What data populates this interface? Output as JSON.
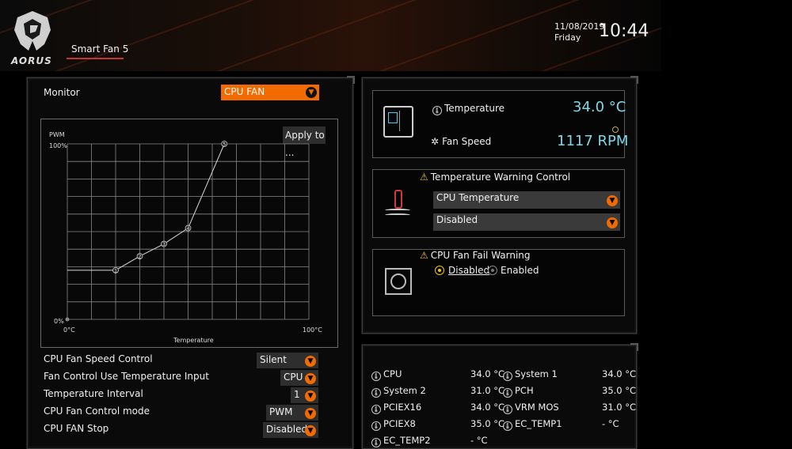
{
  "header": {
    "logo_text": "AORUS",
    "tab_label": "Smart Fan 5",
    "date": "11/08/2019",
    "day": "Friday",
    "time": "10:44"
  },
  "left_panel": {
    "monitor_label": "Monitor",
    "monitor_value": "CPU FAN",
    "apply_button": "Apply to ...",
    "chart_data": {
      "type": "line",
      "ylabel": "PWM",
      "xlabel": "Temperature",
      "y_tick_top": "100%",
      "y_tick_bottom": "0%",
      "x_tick_left": "0°C",
      "x_tick_right": "100°C",
      "xlim": [
        0,
        100
      ],
      "ylim": [
        0,
        100
      ],
      "grid": true,
      "points": [
        {
          "id": "1",
          "x": 20,
          "y": 28
        },
        {
          "id": "2",
          "x": 30,
          "y": 36
        },
        {
          "id": "3",
          "x": 40,
          "y": 43
        },
        {
          "id": "4",
          "x": 50,
          "y": 52
        },
        {
          "id": "5",
          "x": 65,
          "y": 100
        }
      ],
      "start_y": 28
    },
    "settings": [
      {
        "label": "CPU Fan Speed Control",
        "value": "Silent"
      },
      {
        "label": "Fan Control Use Temperature Input",
        "value": "CPU"
      },
      {
        "label": "Temperature Interval",
        "value": "1"
      },
      {
        "label": "CPU Fan Control mode",
        "value": "PWM"
      },
      {
        "label": "CPU FAN Stop",
        "value": "Disabled"
      }
    ]
  },
  "status": {
    "temperature_label": "Temperature",
    "temperature_value": "34.0 °C",
    "fan_speed_label": "Fan Speed",
    "fan_speed_value": "1117 RPM"
  },
  "temp_warning": {
    "title": "Temperature Warning Control",
    "source": "CPU Temperature",
    "level": "Disabled"
  },
  "fan_fail": {
    "title": "CPU Fan Fail Warning",
    "opt_disabled": "Disabled",
    "opt_enabled": "Enabled",
    "selected": "Disabled"
  },
  "sensors": [
    {
      "name": "CPU",
      "value": "34.0 °C"
    },
    {
      "name": "System 1",
      "value": "34.0 °C"
    },
    {
      "name": "System 2",
      "value": "31.0 °C"
    },
    {
      "name": "PCH",
      "value": "35.0 °C"
    },
    {
      "name": "PCIEX16",
      "value": "34.0 °C"
    },
    {
      "name": "VRM MOS",
      "value": "31.0 °C"
    },
    {
      "name": "PCIEX8",
      "value": "35.0 °C"
    },
    {
      "name": "EC_TEMP1",
      "value": "- °C"
    },
    {
      "name": "EC_TEMP2",
      "value": "- °C"
    }
  ],
  "colors": {
    "accent": "#f26b00",
    "value_cyan": "#7fd8e8",
    "warning_yellow": "#f5c400"
  }
}
